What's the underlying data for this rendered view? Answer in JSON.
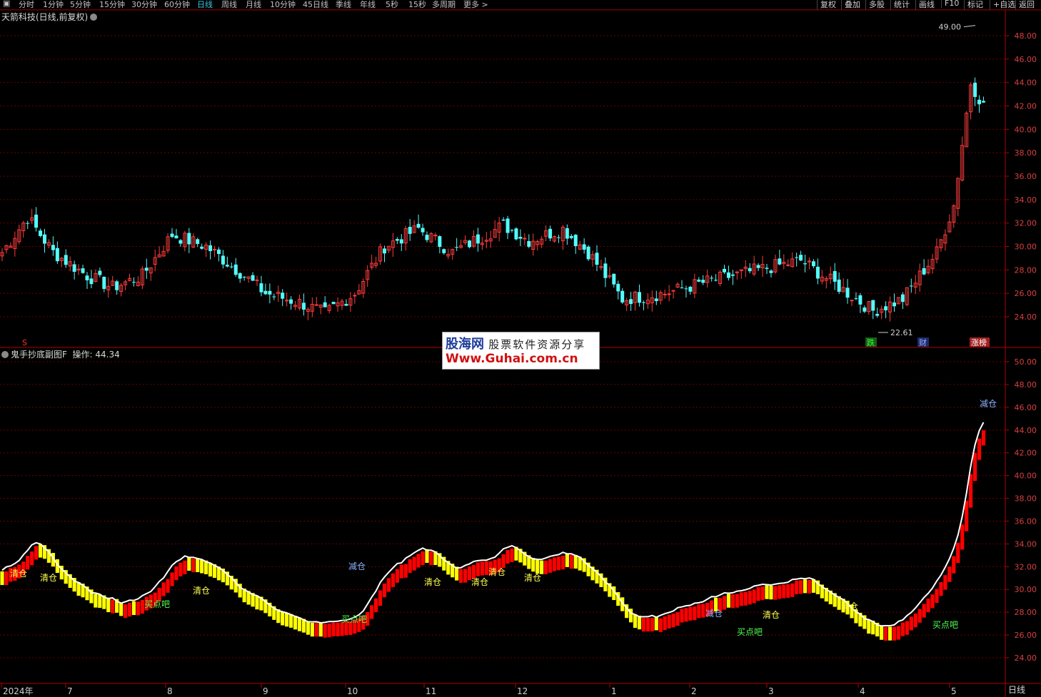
{
  "toolbar": {
    "periods": [
      "分时",
      "1分钟",
      "5分钟",
      "15分钟",
      "30分钟",
      "60分钟",
      "日线",
      "周线",
      "月线",
      "10分钟",
      "45日线",
      "季线",
      "年线",
      "5秒",
      "15秒",
      "多周期",
      "更多 >"
    ],
    "active_period": "日线",
    "right_buttons": [
      "复权",
      "叠加",
      "多股",
      "统计",
      "画线",
      "F10",
      "标记",
      "+自选",
      "返回"
    ]
  },
  "main": {
    "title": "天箭科技(日线,前复权)",
    "y_ticks": [
      "48.00",
      "46.00",
      "44.00",
      "42.00",
      "40.00",
      "38.00",
      "36.00",
      "34.00",
      "32.00",
      "30.00",
      "28.00",
      "26.00",
      "24.00"
    ],
    "high_label": "49.00",
    "low_label": "22.61",
    "markers": [
      "S",
      "跌",
      "财",
      "涨榜"
    ]
  },
  "sub": {
    "title": "鬼手抄底副图F",
    "value_label": "操作: 44.34",
    "y_ticks": [
      "50.00",
      "48.00",
      "46.00",
      "44.00",
      "42.00",
      "40.00",
      "38.00",
      "36.00",
      "34.00",
      "32.00",
      "30.00",
      "28.00",
      "26.00",
      "24.00"
    ],
    "signals": [
      "清仓",
      "清仓",
      "买点吧",
      "清仓",
      "减仓",
      "买点吧",
      "清仓",
      "清仓",
      "清仓",
      "清仓",
      "减仓",
      "买点吧",
      "清仓",
      "清仓",
      "买点吧",
      "减仓"
    ]
  },
  "x_axis": {
    "labels": [
      "2024年",
      "7",
      "8",
      "9",
      "10",
      "11",
      "12",
      "1",
      "2",
      "3",
      "4",
      "5"
    ],
    "period": "日线"
  },
  "watermark": {
    "line1_a": "股海网",
    "line1_b": "股票软件资源分享",
    "line2": "Www.Guhai.com.cn"
  },
  "colors": {
    "up": "#ff3c3c",
    "down": "#54fcfc",
    "grid": "#6e0000",
    "signal_bar_up": "#ff0000",
    "signal_bar_down": "#ffff00",
    "line": "#ffffff"
  }
}
